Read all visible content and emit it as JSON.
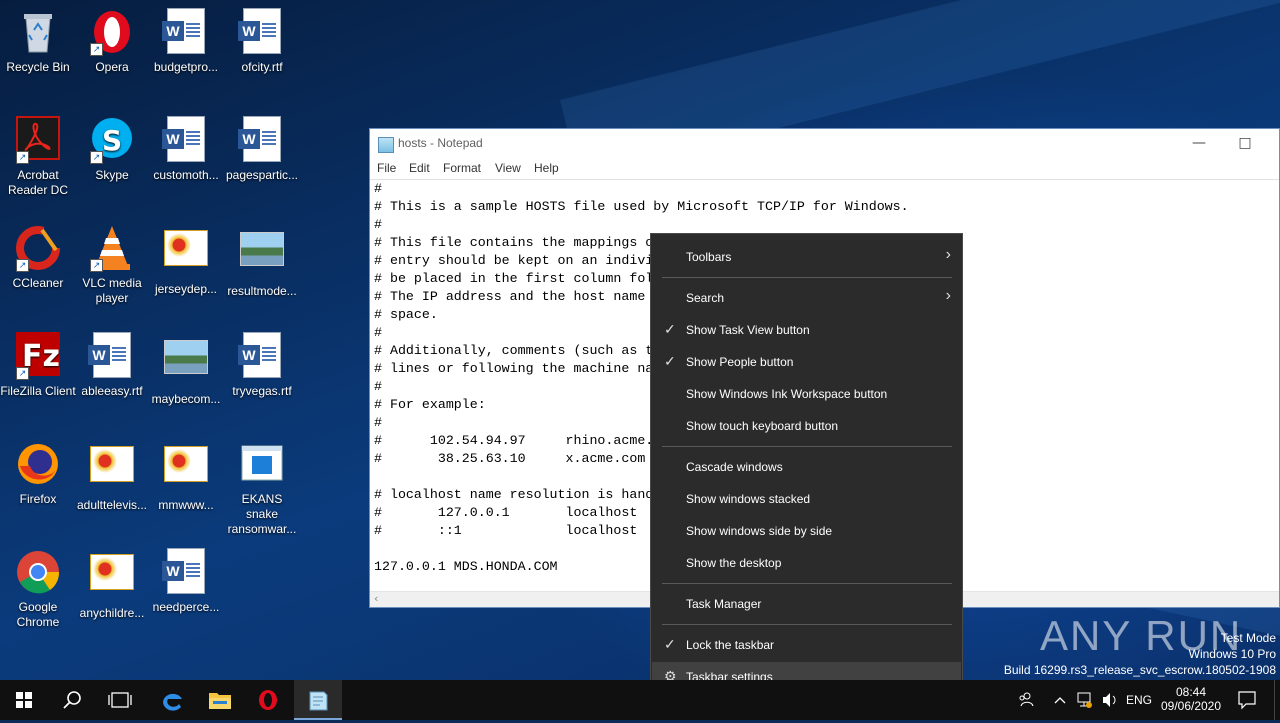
{
  "desktop": {
    "icons": [
      {
        "label": "Recycle Bin"
      },
      {
        "label": "Opera"
      },
      {
        "label": "budgetpro..."
      },
      {
        "label": "ofcity.rtf"
      },
      {
        "label": "Acrobat Reader DC"
      },
      {
        "label": "Skype"
      },
      {
        "label": "customoth..."
      },
      {
        "label": "pagespartic..."
      },
      {
        "label": "CCleaner"
      },
      {
        "label": "VLC media player"
      },
      {
        "label": "jerseydep..."
      },
      {
        "label": "resultmode..."
      },
      {
        "label": "FileZilla Client"
      },
      {
        "label": "ableeasy.rtf"
      },
      {
        "label": "maybecom..."
      },
      {
        "label": "tryvegas.rtf"
      },
      {
        "label": "Firefox"
      },
      {
        "label": "adulttelevis..."
      },
      {
        "label": "mmwww..."
      },
      {
        "label": "EKANS snake ransomwar..."
      },
      {
        "label": "Google Chrome"
      },
      {
        "label": "anychildre..."
      },
      {
        "label": "needperce..."
      }
    ]
  },
  "notepad": {
    "title": "hosts - Notepad",
    "menu": [
      "File",
      "Edit",
      "Format",
      "View",
      "Help"
    ],
    "content": "#\n# This is a sample HOSTS file used by Microsoft TCP/IP for Windows.\n#\n# This file contains the mappings o\n# entry should be kept on an indivi\n# be placed in the first column fol\n# The IP address and the host name\n# space.\n#\n# Additionally, comments (such as t\n# lines or following the machine na\n#\n# For example:\n#\n#      102.54.94.97     rhino.acme.\n#       38.25.63.10     x.acme.com\n\n# localhost name resolution is hand\n#\t127.0.0.1       localhost\n#\t::1             localhost\n\n127.0.0.1 MDS.HONDA.COM"
  },
  "context_menu": {
    "items": [
      {
        "label": "Toolbars",
        "submenu": true,
        "checked": false
      },
      {
        "label": "Search",
        "submenu": true,
        "checked": false
      },
      {
        "label": "Show Task View button",
        "checked": true
      },
      {
        "label": "Show People button",
        "checked": true
      },
      {
        "label": "Show Windows Ink Workspace button",
        "checked": false
      },
      {
        "label": "Show touch keyboard button",
        "checked": false
      },
      {
        "label": "Cascade windows"
      },
      {
        "label": "Show windows stacked"
      },
      {
        "label": "Show windows side by side"
      },
      {
        "label": "Show the desktop"
      },
      {
        "label": "Task Manager"
      },
      {
        "label": "Lock the taskbar",
        "checked": true
      },
      {
        "label": "Taskbar settings",
        "icon": "gear-icon",
        "highlighted": true
      }
    ]
  },
  "watermark": {
    "brand": "ANY RUN",
    "line1": "Test Mode",
    "line2": "Windows 10 Pro",
    "line3": "Build 16299.rs3_release_svc_escrow.180502-1908"
  },
  "taskbar": {
    "language": "ENG",
    "time": "08:44",
    "date": "09/06/2020"
  }
}
